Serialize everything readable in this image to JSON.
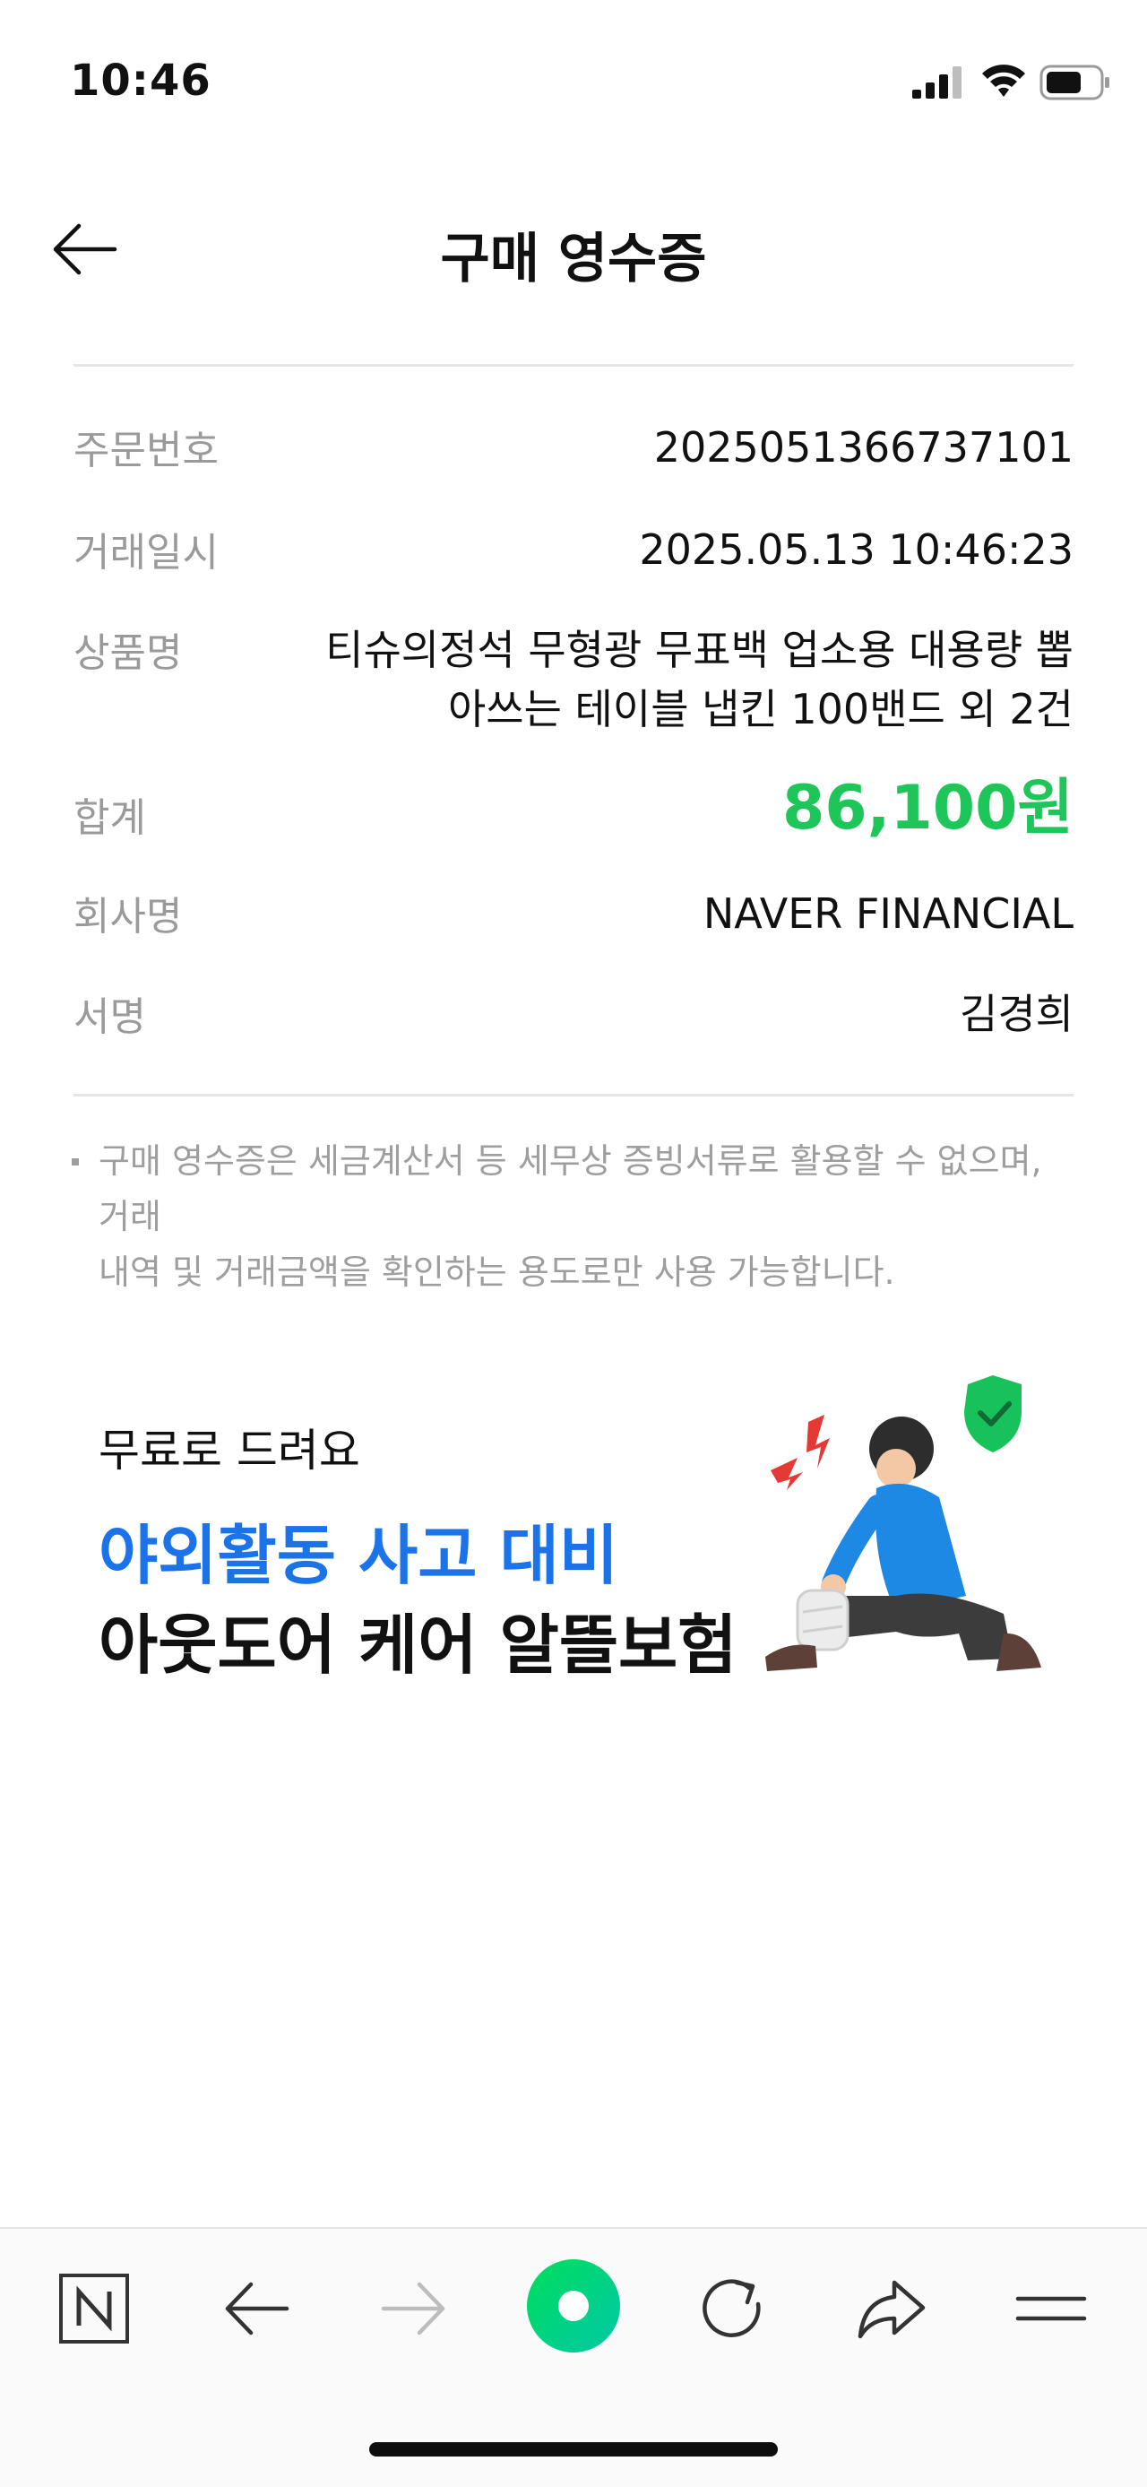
{
  "status_bar": {
    "time": "10:46"
  },
  "header": {
    "title": "구매 영수증"
  },
  "receipt": {
    "rows": [
      {
        "label": "주문번호",
        "value": "2025051366737101"
      },
      {
        "label": "거래일시",
        "value": "2025.05.13 10:46:23"
      },
      {
        "label": "상품명",
        "value_line1": "티슈의정석 무형광 무표백 업소용 대용량 뽑",
        "value_line2": "아쓰는 테이블 냅킨 100밴드 외 2건"
      },
      {
        "label": "합계",
        "value": "86,100원"
      },
      {
        "label": "회사명",
        "value": "NAVER FINANCIAL"
      },
      {
        "label": "서명",
        "value": "김경희"
      }
    ],
    "notice_line1": "구매 영수증은 세금계산서 등 세무상 증빙서류로 활용할 수 없으며, 거래",
    "notice_line2": "내역 및 거래금액을 확인하는 용도로만 사용 가능합니다."
  },
  "banner": {
    "subtitle": "무료로 드려요",
    "title_line1": "야외활동 사고 대비",
    "title_line2": "아웃도어 케어 알뜰보험"
  },
  "bottom_bar": {
    "icons": [
      "naver-n-icon",
      "back-arrow-icon",
      "forward-arrow-icon",
      "green-dot-button-icon",
      "refresh-icon",
      "share-icon",
      "menu-icon"
    ]
  },
  "colors": {
    "total_green": "#1ec65a",
    "banner_blue": "#1a73e8",
    "shield_green": "#18c25a"
  }
}
